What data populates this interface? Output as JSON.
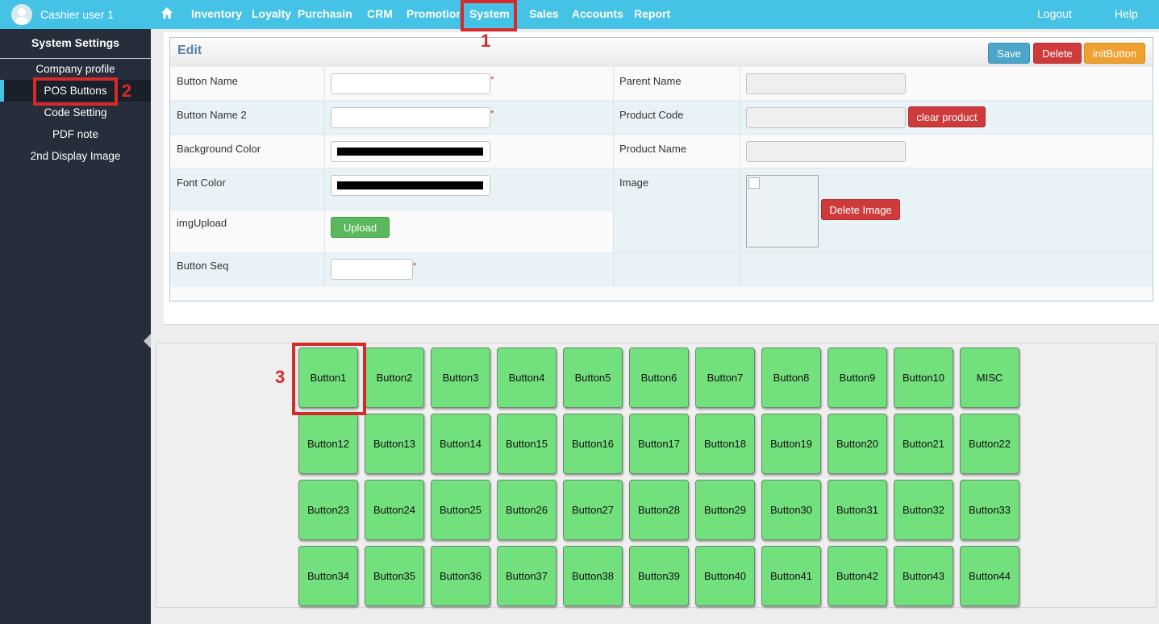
{
  "topbar": {
    "user_name": "Cashier user 1",
    "home_icon": "home-icon",
    "nav": [
      "Inventory",
      "Loyalty",
      "Purchasing",
      "CRM",
      "Promotion",
      "System",
      "Sales",
      "Accounts",
      "Report"
    ],
    "logout": "Logout",
    "help": "Help",
    "color": "#45c3e6"
  },
  "sidebar": {
    "title": "System Settings",
    "items": [
      "Company profile",
      "POS Buttons",
      "Code Setting",
      "PDF note",
      "2nd Display Image"
    ],
    "active_item": "POS Buttons"
  },
  "edit": {
    "title": "Edit",
    "buttons": {
      "save": "Save",
      "delete": "Delete",
      "init": "initButton"
    },
    "fields": {
      "button_name": "Button Name",
      "button_name_2": "Button Name 2",
      "background_color": "Background Color",
      "font_color": "Font Color",
      "img_upload": "imgUpload",
      "upload_button": "Upload",
      "button_seq": "Button Seq",
      "parent_name": "Parent Name",
      "product_code": "Product Code",
      "clear_product": "clear product",
      "product_name": "Product Name",
      "image": "Image",
      "delete_image": "Delete Image"
    },
    "values": {
      "button_name": "",
      "button_name_2": "",
      "background_color": "#000000",
      "font_color": "#000000",
      "button_seq": "",
      "parent_name": "",
      "product_code": "",
      "product_name": ""
    },
    "required_mark": "*"
  },
  "pos_buttons": {
    "rows": [
      [
        "Button1",
        "Button2",
        "Button3",
        "Button4",
        "Button5",
        "Button6",
        "Button7",
        "Button8",
        "Button9",
        "Button10",
        "MISC"
      ],
      [
        "Button12",
        "Button13",
        "Button14",
        "Button15",
        "Button16",
        "Button17",
        "Button18",
        "Button19",
        "Button20",
        "Button21",
        "Button22"
      ],
      [
        "Button23",
        "Button24",
        "Button25",
        "Button26",
        "Button27",
        "Button28",
        "Button29",
        "Button30",
        "Button31",
        "Button32",
        "Button33"
      ],
      [
        "Button34",
        "Button35",
        "Button36",
        "Button37",
        "Button38",
        "Button39",
        "Button40",
        "Button41",
        "Button42",
        "Button43",
        "Button44"
      ]
    ],
    "color": "#72e07d"
  },
  "callouts": [
    "1",
    "2",
    "3"
  ],
  "colors": {
    "callout": "#d62a2a",
    "save": "#4ba6c9",
    "delete": "#cf3b3b",
    "init": "#f0a030",
    "upload": "#5cb85c"
  }
}
